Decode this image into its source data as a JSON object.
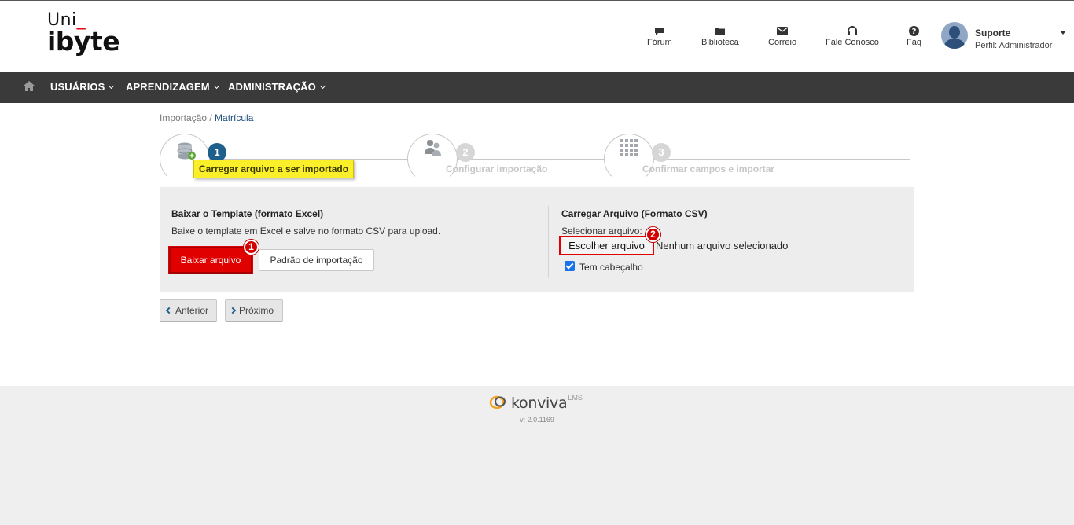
{
  "logo": {
    "line1": "Uni",
    "line1_accent": "_",
    "line2": "ibyte"
  },
  "top_nav": [
    {
      "label": "Fórum",
      "icon": "comment-icon"
    },
    {
      "label": "Biblioteca",
      "icon": "folder-icon"
    },
    {
      "label": "Correio",
      "icon": "envelope-icon"
    },
    {
      "label": "Fale Conosco",
      "icon": "headphones-icon"
    },
    {
      "label": "Faq",
      "icon": "question-icon"
    }
  ],
  "user": {
    "name": "Suporte",
    "role": "Perfil: Administrador"
  },
  "main_menu": [
    {
      "label": "USUÁRIOS"
    },
    {
      "label": "APRENDIZAGEM"
    },
    {
      "label": "ADMINISTRAÇÃO"
    }
  ],
  "breadcrumb": {
    "parent": "Importação",
    "separator": " / ",
    "current": "Matrícula"
  },
  "wizard": {
    "steps": [
      {
        "number": "1",
        "label": "Carregar arquivo a ser importado",
        "active": true,
        "icon": "database-add-icon"
      },
      {
        "number": "2",
        "label": "Configurar importação",
        "active": false,
        "icon": "users-config-icon"
      },
      {
        "number": "3",
        "label": "Confirmar campos e importar",
        "active": false,
        "icon": "grid-icon"
      }
    ]
  },
  "template_section": {
    "title": "Baixar o Template (formato Excel)",
    "description": "Baixe o template em Excel e salve no formato CSV para upload.",
    "download_button": "Baixar arquivo",
    "pattern_button": "Padrão de importação",
    "marker": "1"
  },
  "upload_section": {
    "title": "Carregar Arquivo (Formato CSV)",
    "select_label": "Selecionar arquivo:",
    "choose_button": "Escolher arquivo",
    "no_file_text": "Nenhum arquivo selecionado",
    "header_checkbox_label": "Tem cabeçalho",
    "header_checked": true,
    "marker": "2"
  },
  "pager": {
    "previous": "Anterior",
    "next": "Próximo"
  },
  "footer": {
    "brand": "konviva",
    "brand_suffix": "LMS",
    "version": "v: 2.0.1169"
  },
  "colors": {
    "navbar": "#3a3a3a",
    "accent_blue": "#1f5f8b",
    "primary_red": "#e00000",
    "highlight_yellow": "#fbef2a"
  }
}
